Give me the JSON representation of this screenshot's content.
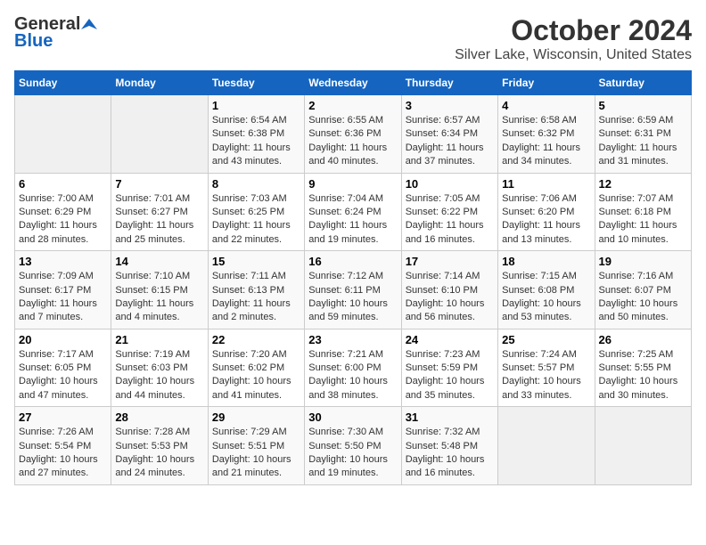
{
  "header": {
    "logo_general": "General",
    "logo_blue": "Blue",
    "month": "October 2024",
    "location": "Silver Lake, Wisconsin, United States"
  },
  "days_of_week": [
    "Sunday",
    "Monday",
    "Tuesday",
    "Wednesday",
    "Thursday",
    "Friday",
    "Saturday"
  ],
  "weeks": [
    [
      {
        "day": "",
        "content": ""
      },
      {
        "day": "",
        "content": ""
      },
      {
        "day": "1",
        "content": "Sunrise: 6:54 AM\nSunset: 6:38 PM\nDaylight: 11 hours and 43 minutes."
      },
      {
        "day": "2",
        "content": "Sunrise: 6:55 AM\nSunset: 6:36 PM\nDaylight: 11 hours and 40 minutes."
      },
      {
        "day": "3",
        "content": "Sunrise: 6:57 AM\nSunset: 6:34 PM\nDaylight: 11 hours and 37 minutes."
      },
      {
        "day": "4",
        "content": "Sunrise: 6:58 AM\nSunset: 6:32 PM\nDaylight: 11 hours and 34 minutes."
      },
      {
        "day": "5",
        "content": "Sunrise: 6:59 AM\nSunset: 6:31 PM\nDaylight: 11 hours and 31 minutes."
      }
    ],
    [
      {
        "day": "6",
        "content": "Sunrise: 7:00 AM\nSunset: 6:29 PM\nDaylight: 11 hours and 28 minutes."
      },
      {
        "day": "7",
        "content": "Sunrise: 7:01 AM\nSunset: 6:27 PM\nDaylight: 11 hours and 25 minutes."
      },
      {
        "day": "8",
        "content": "Sunrise: 7:03 AM\nSunset: 6:25 PM\nDaylight: 11 hours and 22 minutes."
      },
      {
        "day": "9",
        "content": "Sunrise: 7:04 AM\nSunset: 6:24 PM\nDaylight: 11 hours and 19 minutes."
      },
      {
        "day": "10",
        "content": "Sunrise: 7:05 AM\nSunset: 6:22 PM\nDaylight: 11 hours and 16 minutes."
      },
      {
        "day": "11",
        "content": "Sunrise: 7:06 AM\nSunset: 6:20 PM\nDaylight: 11 hours and 13 minutes."
      },
      {
        "day": "12",
        "content": "Sunrise: 7:07 AM\nSunset: 6:18 PM\nDaylight: 11 hours and 10 minutes."
      }
    ],
    [
      {
        "day": "13",
        "content": "Sunrise: 7:09 AM\nSunset: 6:17 PM\nDaylight: 11 hours and 7 minutes."
      },
      {
        "day": "14",
        "content": "Sunrise: 7:10 AM\nSunset: 6:15 PM\nDaylight: 11 hours and 4 minutes."
      },
      {
        "day": "15",
        "content": "Sunrise: 7:11 AM\nSunset: 6:13 PM\nDaylight: 11 hours and 2 minutes."
      },
      {
        "day": "16",
        "content": "Sunrise: 7:12 AM\nSunset: 6:11 PM\nDaylight: 10 hours and 59 minutes."
      },
      {
        "day": "17",
        "content": "Sunrise: 7:14 AM\nSunset: 6:10 PM\nDaylight: 10 hours and 56 minutes."
      },
      {
        "day": "18",
        "content": "Sunrise: 7:15 AM\nSunset: 6:08 PM\nDaylight: 10 hours and 53 minutes."
      },
      {
        "day": "19",
        "content": "Sunrise: 7:16 AM\nSunset: 6:07 PM\nDaylight: 10 hours and 50 minutes."
      }
    ],
    [
      {
        "day": "20",
        "content": "Sunrise: 7:17 AM\nSunset: 6:05 PM\nDaylight: 10 hours and 47 minutes."
      },
      {
        "day": "21",
        "content": "Sunrise: 7:19 AM\nSunset: 6:03 PM\nDaylight: 10 hours and 44 minutes."
      },
      {
        "day": "22",
        "content": "Sunrise: 7:20 AM\nSunset: 6:02 PM\nDaylight: 10 hours and 41 minutes."
      },
      {
        "day": "23",
        "content": "Sunrise: 7:21 AM\nSunset: 6:00 PM\nDaylight: 10 hours and 38 minutes."
      },
      {
        "day": "24",
        "content": "Sunrise: 7:23 AM\nSunset: 5:59 PM\nDaylight: 10 hours and 35 minutes."
      },
      {
        "day": "25",
        "content": "Sunrise: 7:24 AM\nSunset: 5:57 PM\nDaylight: 10 hours and 33 minutes."
      },
      {
        "day": "26",
        "content": "Sunrise: 7:25 AM\nSunset: 5:55 PM\nDaylight: 10 hours and 30 minutes."
      }
    ],
    [
      {
        "day": "27",
        "content": "Sunrise: 7:26 AM\nSunset: 5:54 PM\nDaylight: 10 hours and 27 minutes."
      },
      {
        "day": "28",
        "content": "Sunrise: 7:28 AM\nSunset: 5:53 PM\nDaylight: 10 hours and 24 minutes."
      },
      {
        "day": "29",
        "content": "Sunrise: 7:29 AM\nSunset: 5:51 PM\nDaylight: 10 hours and 21 minutes."
      },
      {
        "day": "30",
        "content": "Sunrise: 7:30 AM\nSunset: 5:50 PM\nDaylight: 10 hours and 19 minutes."
      },
      {
        "day": "31",
        "content": "Sunrise: 7:32 AM\nSunset: 5:48 PM\nDaylight: 10 hours and 16 minutes."
      },
      {
        "day": "",
        "content": ""
      },
      {
        "day": "",
        "content": ""
      }
    ]
  ]
}
